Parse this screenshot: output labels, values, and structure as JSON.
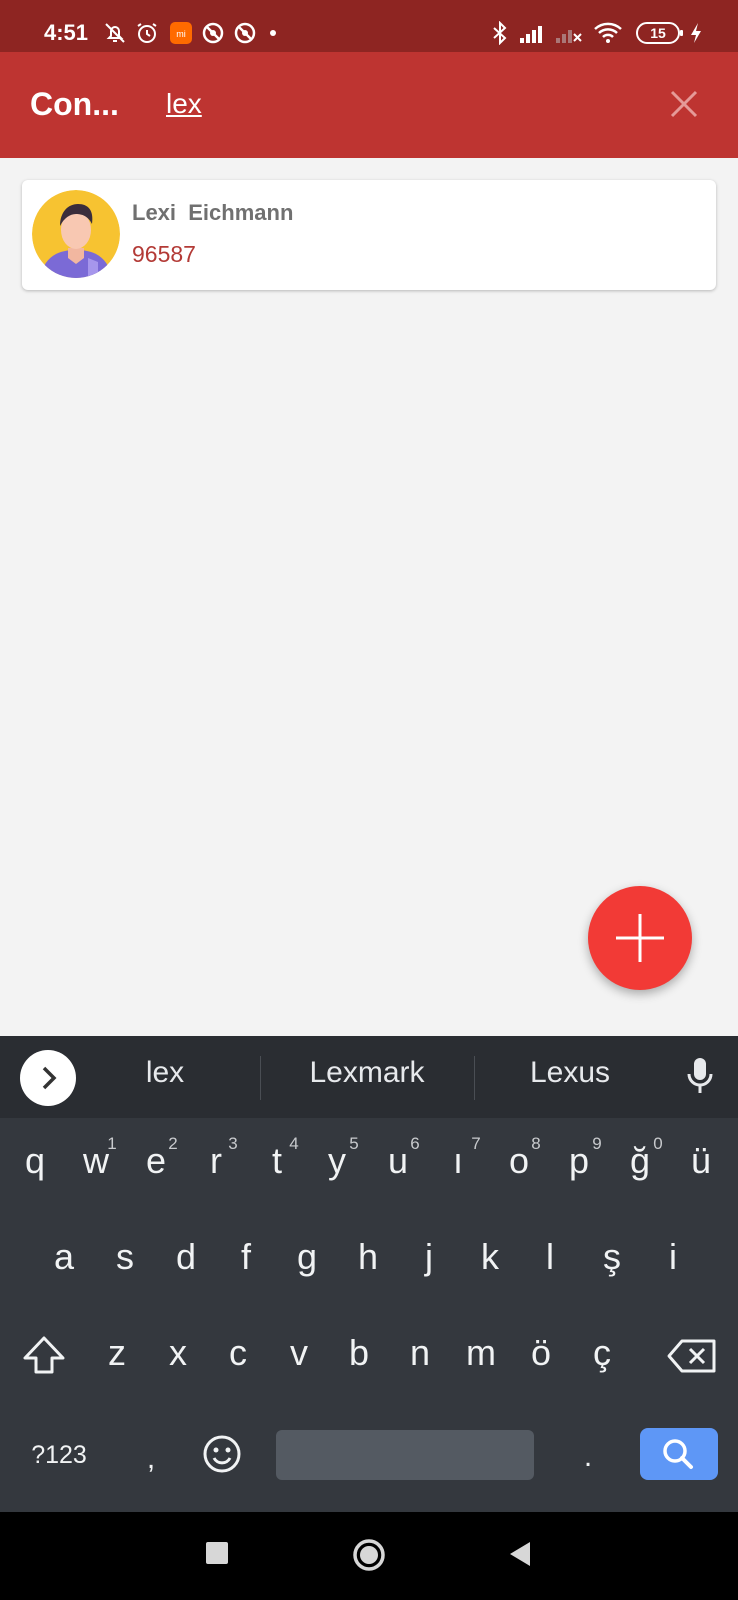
{
  "status_bar": {
    "time": "4:51",
    "battery": "15",
    "icons": [
      "mute-bell-icon",
      "alarm-icon",
      "mi-app-icon",
      "blocked-icon",
      "blocked-icon",
      "dot-icon",
      "bluetooth-icon",
      "signal-icon",
      "signal-off-icon",
      "wifi-icon",
      "battery-icon",
      "charging-icon"
    ]
  },
  "app_bar": {
    "title": "Con...",
    "search_query": "lex",
    "close_icon": "close-icon",
    "color": "#be3431"
  },
  "contacts": [
    {
      "name": "Lexi  Eichmann",
      "phone": "96587"
    }
  ],
  "fab": {
    "icon": "plus-icon",
    "color": "#f23a36"
  },
  "keyboard": {
    "suggestions": [
      "lex",
      "Lexmark",
      "Lexus"
    ],
    "row1": [
      "q",
      "w",
      "e",
      "r",
      "t",
      "y",
      "u",
      "ı",
      "o",
      "p",
      "ğ",
      "ü"
    ],
    "row1_hints": [
      "1",
      "2",
      "3",
      "4",
      "5",
      "6",
      "7",
      "8",
      "9",
      "0"
    ],
    "row2": [
      "a",
      "s",
      "d",
      "f",
      "g",
      "h",
      "j",
      "k",
      "l",
      "ş",
      "i"
    ],
    "row3": [
      "z",
      "x",
      "c",
      "v",
      "b",
      "n",
      "m",
      "ö",
      "ç"
    ],
    "symbols_key": "?123",
    "comma_key": ",",
    "period_key": ".",
    "accent": "#5e97f6"
  },
  "nav_bar": {
    "icons": [
      "recents-icon",
      "home-icon",
      "back-icon"
    ]
  }
}
